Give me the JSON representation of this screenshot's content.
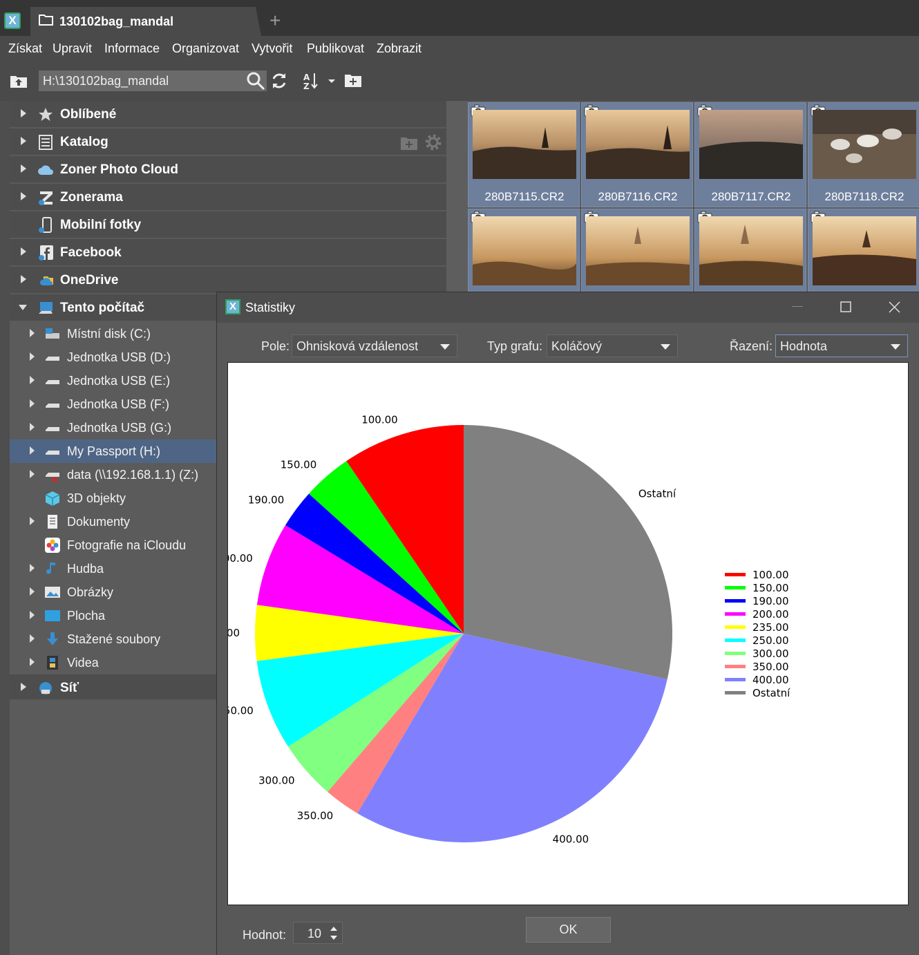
{
  "window": {
    "tab_title": "130102bag_mandal",
    "add_tab": "+"
  },
  "menu": [
    "Získat",
    "Upravit",
    "Informace",
    "Organizovat",
    "Vytvořit",
    "Publikovat",
    "Zobrazit"
  ],
  "toolbar": {
    "path": "H:\\130102bag_mandal"
  },
  "nav_top": [
    {
      "label": "Oblíbené",
      "icon": "star-icon"
    },
    {
      "label": "Katalog",
      "icon": "catalog-icon"
    },
    {
      "label": "Zoner Photo Cloud",
      "icon": "cloud-icon"
    },
    {
      "label": "Zonerama",
      "icon": "zonerama-icon"
    },
    {
      "label": "Mobilní fotky",
      "icon": "phone-icon"
    },
    {
      "label": "Facebook",
      "icon": "facebook-icon"
    },
    {
      "label": "OneDrive",
      "icon": "onedrive-icon"
    }
  ],
  "this_pc": {
    "label": "Tento počítač"
  },
  "drives": [
    {
      "label": "Místní disk (C:)",
      "icon": "hard-disk-icon"
    },
    {
      "label": "Jednotka USB (D:)",
      "icon": "usb-drive-icon"
    },
    {
      "label": "Jednotka USB (E:)",
      "icon": "usb-drive-icon"
    },
    {
      "label": "Jednotka USB (F:)",
      "icon": "usb-drive-icon"
    },
    {
      "label": "Jednotka USB (G:)",
      "icon": "usb-drive-icon"
    },
    {
      "label": "My Passport (H:)",
      "icon": "usb-drive-icon"
    },
    {
      "label": "data (\\\\192.168.1.1) (Z:)",
      "icon": "network-drive-icon"
    },
    {
      "label": "3D objekty",
      "icon": "3d-objects-icon"
    },
    {
      "label": "Dokumenty",
      "icon": "documents-icon"
    },
    {
      "label": "Fotografie na iCloudu",
      "icon": "icloud-photos-icon"
    },
    {
      "label": "Hudba",
      "icon": "music-icon"
    },
    {
      "label": "Obrázky",
      "icon": "pictures-icon"
    },
    {
      "label": "Plocha",
      "icon": "desktop-icon"
    },
    {
      "label": "Stažené soubory",
      "icon": "downloads-icon"
    },
    {
      "label": "Videa",
      "icon": "videos-icon"
    }
  ],
  "network": {
    "label": "Síť"
  },
  "thumbnails": [
    "280B7115.CR2",
    "280B7116.CR2",
    "280B7117.CR2",
    "280B7118.CR2",
    "",
    "",
    "",
    ""
  ],
  "dialog": {
    "title": "Statistiky",
    "field_label": "Pole:",
    "field_value": "Ohnisková vzdálenost",
    "chart_type_label": "Typ grafu:",
    "chart_type_value": "Koláčový",
    "sort_label": "Řazení:",
    "sort_value": "Hodnota",
    "values_label": "Hodnot:",
    "values_count": "10",
    "ok": "OK"
  },
  "chart_data": {
    "type": "pie",
    "title": "",
    "categories": [
      "100.00",
      "150.00",
      "190.00",
      "200.00",
      "235.00",
      "250.00",
      "300.00",
      "350.00",
      "400.00",
      "Ostatní"
    ],
    "values": [
      9.5,
      3.8,
      3.0,
      6.5,
      4.3,
      7.0,
      4.6,
      2.8,
      30.0,
      28.5
    ],
    "colors": [
      "#ff0000",
      "#00ff00",
      "#0000ff",
      "#ff00ff",
      "#ffff00",
      "#00ffff",
      "#80ff80",
      "#ff8080",
      "#8080ff",
      "#808080"
    ],
    "legend": "right"
  }
}
